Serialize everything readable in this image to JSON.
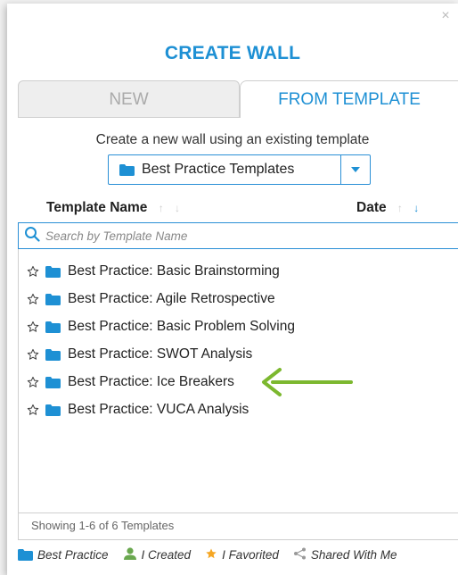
{
  "dialog": {
    "title": "CREATE WALL",
    "close_icon": "close-icon",
    "tabs": [
      {
        "label": "NEW",
        "active": false
      },
      {
        "label": "FROM TEMPLATE",
        "active": true
      }
    ],
    "subtitle": "Create a new wall using an existing template",
    "template_select": {
      "selected": "Best Practice Templates"
    },
    "columns": {
      "name": "Template Name",
      "date": "Date",
      "sort_up": "↑",
      "sort_down": "↓"
    },
    "search": {
      "placeholder": "Search by Template Name",
      "value": ""
    },
    "templates": [
      {
        "name": "Best Practice: Basic Brainstorming"
      },
      {
        "name": "Best Practice: Agile Retrospective"
      },
      {
        "name": "Best Practice: Basic Problem Solving"
      },
      {
        "name": "Best Practice: SWOT Analysis"
      },
      {
        "name": "Best Practice: Ice Breakers"
      },
      {
        "name": "Best Practice: VUCA Analysis"
      }
    ],
    "status": "Showing 1-6 of 6 Templates",
    "legend": [
      {
        "label": "Best Practice",
        "icon": "folder-icon"
      },
      {
        "label": "I Created",
        "icon": "user-icon"
      },
      {
        "label": "I Favorited",
        "icon": "star-icon"
      },
      {
        "label": "Shared With Me",
        "icon": "share-icon"
      }
    ]
  },
  "colors": {
    "accent": "#1e90d4",
    "annotation_arrow": "#7cb82f",
    "favorite": "#f5a623",
    "user": "#6aa84f"
  }
}
